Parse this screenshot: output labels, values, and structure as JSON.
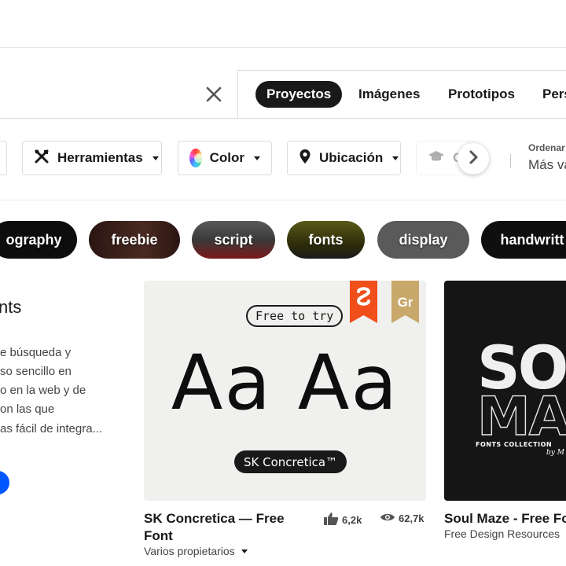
{
  "search": {
    "clear_icon": "close-icon"
  },
  "tabs": [
    {
      "label": "Proyectos",
      "active": true
    },
    {
      "label": "Imágenes",
      "active": false
    },
    {
      "label": "Prototipos",
      "active": false
    },
    {
      "label": "Pers",
      "active": false
    }
  ],
  "filters": {
    "tools_label": "Herramientas",
    "color_label": "Color",
    "location_label": "Ubicación",
    "faded_label": "C"
  },
  "sort": {
    "label": "Ordenar",
    "value": "Más va"
  },
  "tags": [
    "ography",
    "freebie",
    "script",
    "fonts",
    "display",
    "handwritt"
  ],
  "intro": {
    "title": "nts",
    "lines": [
      "e búsqueda y",
      "so sencillo en",
      "o en la web y de",
      "on las que",
      "as fácil de integra..."
    ]
  },
  "cards": [
    {
      "title": "SK Concretica — Free Font",
      "owner": "Varios propietarios",
      "likes": "6,2k",
      "views": "62,7k",
      "image": {
        "free_to_try": "Free to try",
        "specimen": "Aa Aa",
        "font_name": "SK Concretica™",
        "badge_gr": "Gr",
        "badge_colors": [
          "#f04e1b",
          "#c8a86b"
        ]
      }
    },
    {
      "title": "Soul Maze - Free Fo",
      "owner": "Free Design Resources",
      "image": {
        "big_word_1": "SOU",
        "big_word_2": "MA",
        "caption": "FONTS COLLECTION",
        "byline": "by M"
      }
    }
  ],
  "colors": {
    "accent": "#191919",
    "blue": "#0057ff"
  }
}
